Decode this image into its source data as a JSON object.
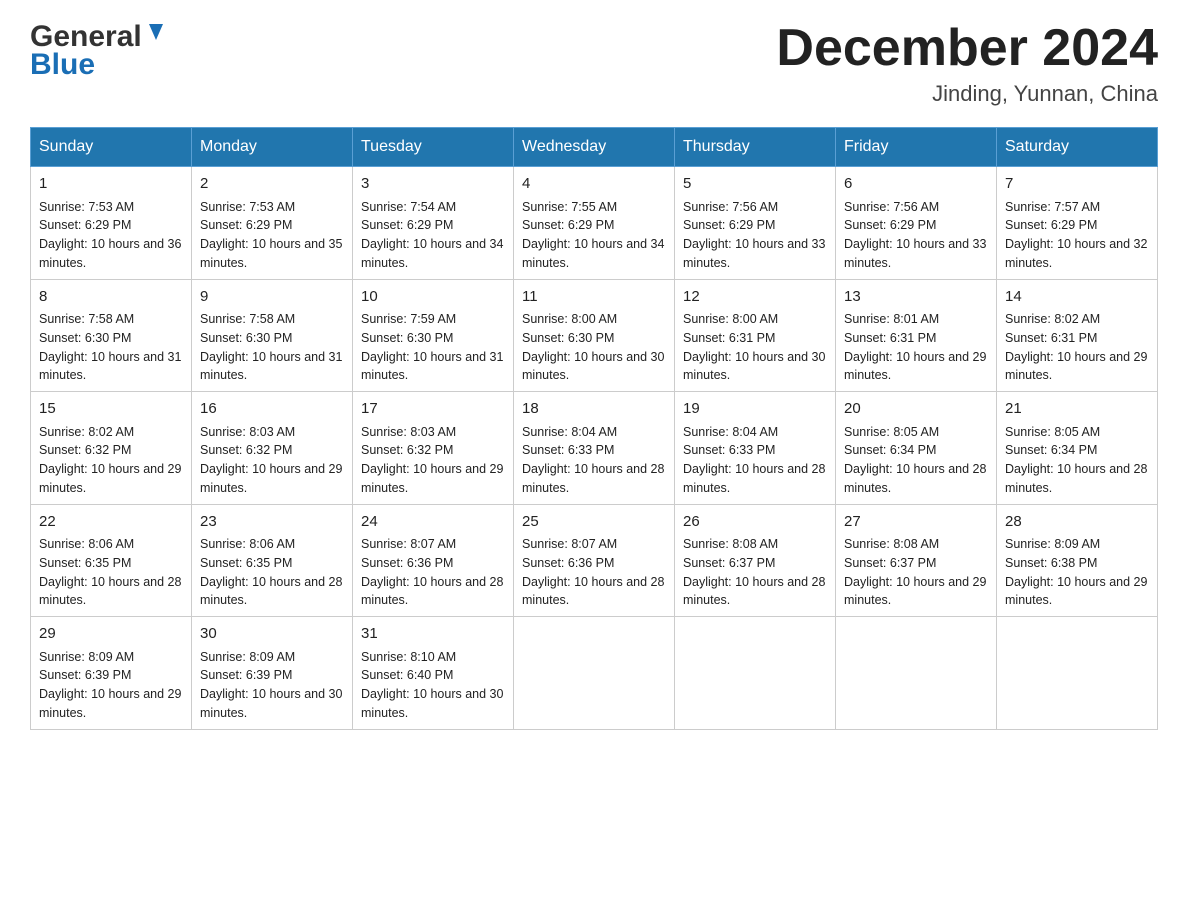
{
  "logo": {
    "general": "General",
    "blue": "Blue"
  },
  "title": "December 2024",
  "subtitle": "Jinding, Yunnan, China",
  "days_of_week": [
    "Sunday",
    "Monday",
    "Tuesday",
    "Wednesday",
    "Thursday",
    "Friday",
    "Saturday"
  ],
  "weeks": [
    [
      {
        "day": "1",
        "sunrise": "Sunrise: 7:53 AM",
        "sunset": "Sunset: 6:29 PM",
        "daylight": "Daylight: 10 hours and 36 minutes."
      },
      {
        "day": "2",
        "sunrise": "Sunrise: 7:53 AM",
        "sunset": "Sunset: 6:29 PM",
        "daylight": "Daylight: 10 hours and 35 minutes."
      },
      {
        "day": "3",
        "sunrise": "Sunrise: 7:54 AM",
        "sunset": "Sunset: 6:29 PM",
        "daylight": "Daylight: 10 hours and 34 minutes."
      },
      {
        "day": "4",
        "sunrise": "Sunrise: 7:55 AM",
        "sunset": "Sunset: 6:29 PM",
        "daylight": "Daylight: 10 hours and 34 minutes."
      },
      {
        "day": "5",
        "sunrise": "Sunrise: 7:56 AM",
        "sunset": "Sunset: 6:29 PM",
        "daylight": "Daylight: 10 hours and 33 minutes."
      },
      {
        "day": "6",
        "sunrise": "Sunrise: 7:56 AM",
        "sunset": "Sunset: 6:29 PM",
        "daylight": "Daylight: 10 hours and 33 minutes."
      },
      {
        "day": "7",
        "sunrise": "Sunrise: 7:57 AM",
        "sunset": "Sunset: 6:29 PM",
        "daylight": "Daylight: 10 hours and 32 minutes."
      }
    ],
    [
      {
        "day": "8",
        "sunrise": "Sunrise: 7:58 AM",
        "sunset": "Sunset: 6:30 PM",
        "daylight": "Daylight: 10 hours and 31 minutes."
      },
      {
        "day": "9",
        "sunrise": "Sunrise: 7:58 AM",
        "sunset": "Sunset: 6:30 PM",
        "daylight": "Daylight: 10 hours and 31 minutes."
      },
      {
        "day": "10",
        "sunrise": "Sunrise: 7:59 AM",
        "sunset": "Sunset: 6:30 PM",
        "daylight": "Daylight: 10 hours and 31 minutes."
      },
      {
        "day": "11",
        "sunrise": "Sunrise: 8:00 AM",
        "sunset": "Sunset: 6:30 PM",
        "daylight": "Daylight: 10 hours and 30 minutes."
      },
      {
        "day": "12",
        "sunrise": "Sunrise: 8:00 AM",
        "sunset": "Sunset: 6:31 PM",
        "daylight": "Daylight: 10 hours and 30 minutes."
      },
      {
        "day": "13",
        "sunrise": "Sunrise: 8:01 AM",
        "sunset": "Sunset: 6:31 PM",
        "daylight": "Daylight: 10 hours and 29 minutes."
      },
      {
        "day": "14",
        "sunrise": "Sunrise: 8:02 AM",
        "sunset": "Sunset: 6:31 PM",
        "daylight": "Daylight: 10 hours and 29 minutes."
      }
    ],
    [
      {
        "day": "15",
        "sunrise": "Sunrise: 8:02 AM",
        "sunset": "Sunset: 6:32 PM",
        "daylight": "Daylight: 10 hours and 29 minutes."
      },
      {
        "day": "16",
        "sunrise": "Sunrise: 8:03 AM",
        "sunset": "Sunset: 6:32 PM",
        "daylight": "Daylight: 10 hours and 29 minutes."
      },
      {
        "day": "17",
        "sunrise": "Sunrise: 8:03 AM",
        "sunset": "Sunset: 6:32 PM",
        "daylight": "Daylight: 10 hours and 29 minutes."
      },
      {
        "day": "18",
        "sunrise": "Sunrise: 8:04 AM",
        "sunset": "Sunset: 6:33 PM",
        "daylight": "Daylight: 10 hours and 28 minutes."
      },
      {
        "day": "19",
        "sunrise": "Sunrise: 8:04 AM",
        "sunset": "Sunset: 6:33 PM",
        "daylight": "Daylight: 10 hours and 28 minutes."
      },
      {
        "day": "20",
        "sunrise": "Sunrise: 8:05 AM",
        "sunset": "Sunset: 6:34 PM",
        "daylight": "Daylight: 10 hours and 28 minutes."
      },
      {
        "day": "21",
        "sunrise": "Sunrise: 8:05 AM",
        "sunset": "Sunset: 6:34 PM",
        "daylight": "Daylight: 10 hours and 28 minutes."
      }
    ],
    [
      {
        "day": "22",
        "sunrise": "Sunrise: 8:06 AM",
        "sunset": "Sunset: 6:35 PM",
        "daylight": "Daylight: 10 hours and 28 minutes."
      },
      {
        "day": "23",
        "sunrise": "Sunrise: 8:06 AM",
        "sunset": "Sunset: 6:35 PM",
        "daylight": "Daylight: 10 hours and 28 minutes."
      },
      {
        "day": "24",
        "sunrise": "Sunrise: 8:07 AM",
        "sunset": "Sunset: 6:36 PM",
        "daylight": "Daylight: 10 hours and 28 minutes."
      },
      {
        "day": "25",
        "sunrise": "Sunrise: 8:07 AM",
        "sunset": "Sunset: 6:36 PM",
        "daylight": "Daylight: 10 hours and 28 minutes."
      },
      {
        "day": "26",
        "sunrise": "Sunrise: 8:08 AM",
        "sunset": "Sunset: 6:37 PM",
        "daylight": "Daylight: 10 hours and 28 minutes."
      },
      {
        "day": "27",
        "sunrise": "Sunrise: 8:08 AM",
        "sunset": "Sunset: 6:37 PM",
        "daylight": "Daylight: 10 hours and 29 minutes."
      },
      {
        "day": "28",
        "sunrise": "Sunrise: 8:09 AM",
        "sunset": "Sunset: 6:38 PM",
        "daylight": "Daylight: 10 hours and 29 minutes."
      }
    ],
    [
      {
        "day": "29",
        "sunrise": "Sunrise: 8:09 AM",
        "sunset": "Sunset: 6:39 PM",
        "daylight": "Daylight: 10 hours and 29 minutes."
      },
      {
        "day": "30",
        "sunrise": "Sunrise: 8:09 AM",
        "sunset": "Sunset: 6:39 PM",
        "daylight": "Daylight: 10 hours and 30 minutes."
      },
      {
        "day": "31",
        "sunrise": "Sunrise: 8:10 AM",
        "sunset": "Sunset: 6:40 PM",
        "daylight": "Daylight: 10 hours and 30 minutes."
      },
      {
        "day": "",
        "sunrise": "",
        "sunset": "",
        "daylight": ""
      },
      {
        "day": "",
        "sunrise": "",
        "sunset": "",
        "daylight": ""
      },
      {
        "day": "",
        "sunrise": "",
        "sunset": "",
        "daylight": ""
      },
      {
        "day": "",
        "sunrise": "",
        "sunset": "",
        "daylight": ""
      }
    ]
  ]
}
